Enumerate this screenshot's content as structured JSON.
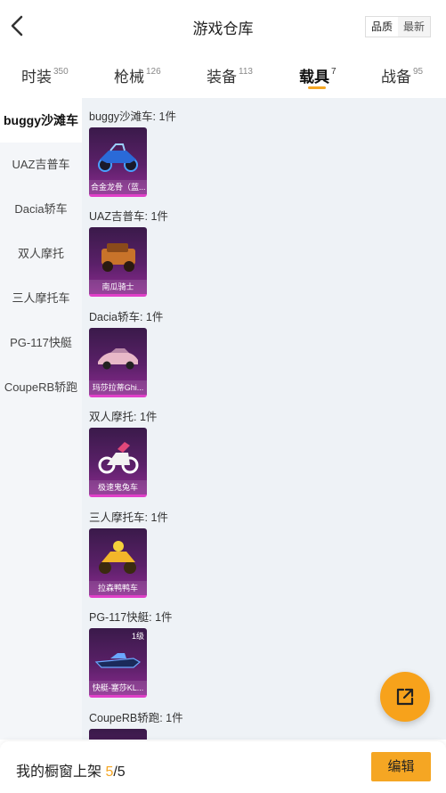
{
  "header": {
    "title": "游戏仓库",
    "sort": {
      "quality": "品质",
      "latest": "最新"
    }
  },
  "tabs": [
    {
      "label": "时装",
      "count": "350"
    },
    {
      "label": "枪械",
      "count": "126"
    },
    {
      "label": "装备",
      "count": "113"
    },
    {
      "label": "载具",
      "count": "7"
    },
    {
      "label": "战备",
      "count": "95"
    }
  ],
  "sidebar": {
    "items": [
      {
        "label": "buggy沙滩车"
      },
      {
        "label": "UAZ吉普车"
      },
      {
        "label": "Dacia轿车"
      },
      {
        "label": "双人摩托"
      },
      {
        "label": "三人摩托车"
      },
      {
        "label": "PG-117快艇"
      },
      {
        "label": "CoupeRB轿跑"
      }
    ]
  },
  "sections": [
    {
      "title": "buggy沙滩车: 1件",
      "item": {
        "name": "合金龙骨（蓝...",
        "icon": "buggy-icon"
      }
    },
    {
      "title": "UAZ吉普车: 1件",
      "item": {
        "name": "南瓜骑士",
        "icon": "jeep-icon"
      }
    },
    {
      "title": "Dacia轿车: 1件",
      "item": {
        "name": "玛莎拉蒂Ghi...",
        "icon": "sedan-icon"
      }
    },
    {
      "title": "双人摩托: 1件",
      "item": {
        "name": "极速鬼兔车",
        "icon": "motorcycle-icon"
      }
    },
    {
      "title": "三人摩托车: 1件",
      "item": {
        "name": "拉森鸭鸭车",
        "icon": "trike-icon"
      }
    },
    {
      "title": "PG-117快艇: 1件",
      "item": {
        "name": "快艇-塞莎KL...",
        "icon": "boat-icon",
        "level": "1级"
      }
    },
    {
      "title": "CoupeRB轿跑: 1件",
      "item": {
        "name": "",
        "icon": "coupe-icon"
      }
    }
  ],
  "bottom": {
    "label": "我的橱窗上架 ",
    "current": "5",
    "total": "/5",
    "edit_label": "编辑"
  },
  "colors": {
    "accent": "#f5a623",
    "card_bg": "#5a2068",
    "card_edge": "#e040c8"
  }
}
